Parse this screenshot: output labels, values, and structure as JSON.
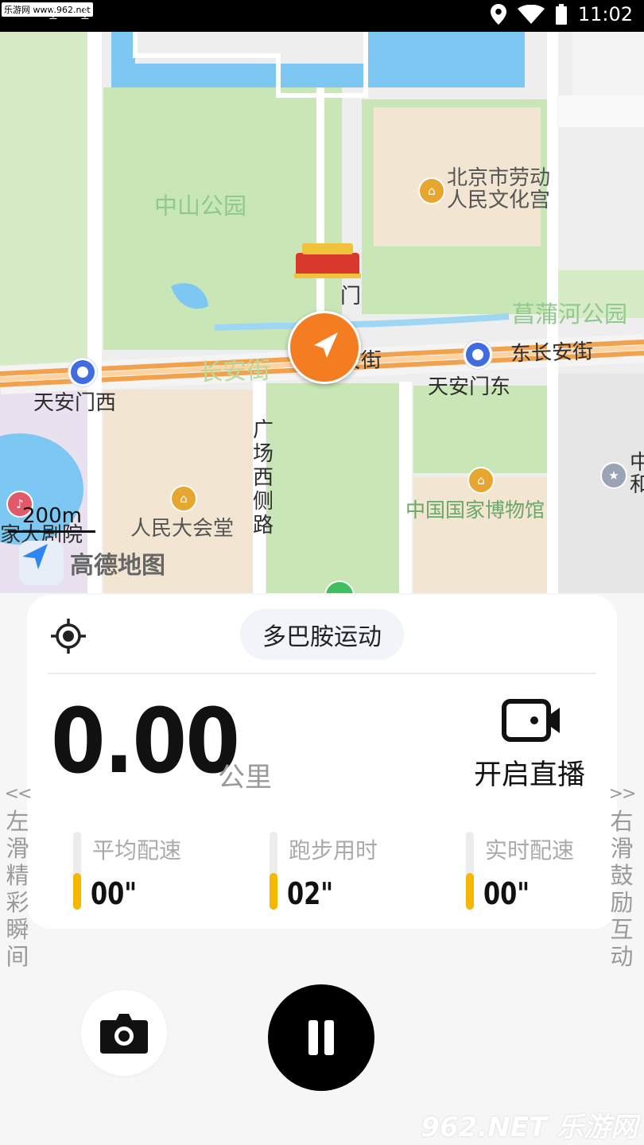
{
  "status_bar": {
    "watermark": "乐游网 www.962.net",
    "time": "11:02"
  },
  "map": {
    "labels": {
      "zhongshan_park": "中山公园",
      "labor_palace": "北京市劳动\n人民文化宫",
      "tiananmen_partial": "门",
      "changpuhe_park": "菖蒲河公园",
      "changan_street": "长安街",
      "west_changan": "西长安街",
      "east_changan": "东长安街",
      "tiananmen_west": "天安门西",
      "tiananmen_east": "天安门东",
      "guangchang_west_road": "广\n场\n西\n侧\n路",
      "great_hall": "人民大会堂",
      "national_museum": "中国国家博物馆",
      "national_theater": "家大剧院",
      "right_edge": "中\n和"
    },
    "scale": "200m",
    "provider": "高德地图"
  },
  "card": {
    "sport_name": "多巴胺运动",
    "distance": "0.00",
    "distance_unit": "公里",
    "live_label": "开启直播",
    "stats": [
      {
        "label": "平均配速",
        "value": "00\""
      },
      {
        "label": "跑步用时",
        "value": "02\""
      },
      {
        "label": "实时配速",
        "value": "00\""
      }
    ]
  },
  "side_left": {
    "arrows": "<<",
    "text": "左滑精彩瞬间"
  },
  "side_right": {
    "arrows": ">>",
    "text": "右滑鼓励互动"
  },
  "footer_watermark": "962.NET 乐游网",
  "colors": {
    "accent_orange": "#f47d21",
    "stat_yellow": "#f5b800",
    "metro_blue": "#3f6de0",
    "park_green": "#c8e6b8"
  }
}
